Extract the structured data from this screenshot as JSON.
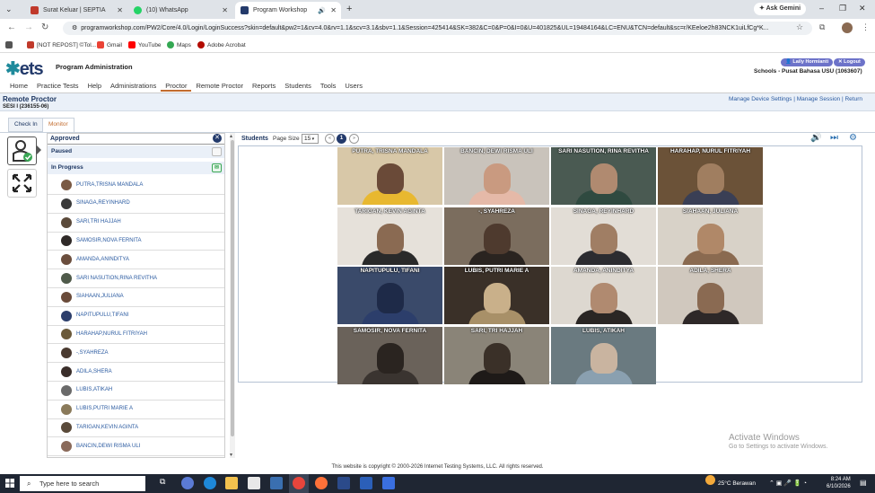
{
  "browser": {
    "tabs": [
      {
        "title": "Surat Keluar | SEPTIA",
        "color": "#c0392b"
      },
      {
        "title": "(10) WhatsApp",
        "color": "#25d366"
      },
      {
        "title": "Program Workshop",
        "color": "#233a6b"
      }
    ],
    "url": "programworkshop.com/PW2/Core/4.0/Login/LoginSuccess?skin=default&pw2=1&cv=4.0&rv=1.1&scv=3.1&sbv=1.1&Session=425414&SK=382&C=0&P=0&I=0&U=401825&UL=19484164&LC=ENU&TCN=default&sc=r/KEeloe2h83NCK1uiLfCg*K...",
    "gemini_label": "Ask Gemini",
    "bookmarks": [
      "[NOT REPOST] ©Tol...",
      "Gmail",
      "YouTube",
      "Maps",
      "Adobe Acrobat"
    ]
  },
  "header": {
    "logo_main": "ets",
    "app_title": "Program Administration",
    "user_button": "Laily Hormianti",
    "logout_button": "Logout",
    "school": "Schools - Pusat Bahasa USU (1063607)"
  },
  "menu": [
    "Home",
    "Practice Tests",
    "Help",
    "Administrations",
    "Proctor",
    "Remote Proctor",
    "Reports",
    "Students",
    "Tools",
    "Users"
  ],
  "menu_selected": "Proctor",
  "subheader": {
    "title": "Remote Proctor",
    "session": "SESI I (236155-06)",
    "links": [
      "Manage Device Settings",
      "Manage Session",
      "Return"
    ]
  },
  "tabs": [
    "Check In",
    "Monitor"
  ],
  "active_tab": "Monitor",
  "left_panel": {
    "approved": "Approved",
    "paused": "Paused",
    "in_progress": "In Progress",
    "students": [
      {
        "name": "PUTRA,TRISNA MANDALA",
        "color": "#7a5a44"
      },
      {
        "name": "SINAGA,REYINHARD",
        "color": "#3a3a3a"
      },
      {
        "name": "SARI,TRI HAJJAH",
        "color": "#5b4a3a"
      },
      {
        "name": "SAMOSIR,NOVA FERNITA",
        "color": "#2f2a28"
      },
      {
        "name": "AMANDA,ANINDITYA",
        "color": "#6b4e3d"
      },
      {
        "name": "SARI NASUTION,RINA REVITHA",
        "color": "#4f5a4a"
      },
      {
        "name": "SIAHAAN,JULIANA",
        "color": "#6a4b3a"
      },
      {
        "name": "NAPITUPULU,TIFANI",
        "color": "#2c3e6b"
      },
      {
        "name": "HARAHAP,NURUL FITRIYAH",
        "color": "#6b5a3a"
      },
      {
        "name": "-,SYAHREZA",
        "color": "#4a3a30"
      },
      {
        "name": "ADILA,SHERA",
        "color": "#3a2e2a"
      },
      {
        "name": "LUBIS,ATIKAH",
        "color": "#6a6a6a"
      },
      {
        "name": "LUBIS,PUTRI MARIE A",
        "color": "#8a7a5a"
      },
      {
        "name": "TARIGAN,KEVIN AGINTA",
        "color": "#5a4a3a"
      },
      {
        "name": "BANCIN,DEWI RISMA ULI",
        "color": "#8a6a5a"
      }
    ]
  },
  "monitor": {
    "students_label": "Students",
    "page_size_label": "Page Size",
    "page_size": "15",
    "page_number": "1",
    "tiles": [
      {
        "label": "PUTRA, TRISNA MANDALA",
        "bg": "#d8c8a8",
        "face": "#6a4a38",
        "body": "#e8b830"
      },
      {
        "label": "BANCIN, DEWI RISMA ULI",
        "bg": "#c9c3bb",
        "face": "#c99a80",
        "body": "#e5b9a8"
      },
      {
        "label": "SARI NASUTION, RINA REVITHA",
        "bg": "#4a5a52",
        "face": "#b08a70",
        "body": "#2f4a40"
      },
      {
        "label": "HARAHAP, NURUL FITRIYAH",
        "bg": "#6b5238",
        "face": "#a07e60",
        "body": "#3a3f55"
      },
      {
        "label": "TARIGAN, KEVIN AGINTA",
        "bg": "#e6e1da",
        "face": "#8a6a52",
        "body": "#2a2a2a"
      },
      {
        "label": "-, SYAHREZA",
        "bg": "#7b6d5e",
        "face": "#4e3a2e",
        "body": "#2a2420"
      },
      {
        "label": "SINAGA, REYINHARD",
        "bg": "#e2ddd6",
        "face": "#a07e64",
        "body": "#2c2c30"
      },
      {
        "label": "SIAHAAN, JULIANA",
        "bg": "#d8d2c8",
        "face": "#b08868",
        "body": "#8a6a50"
      },
      {
        "label": "NAPITUPULU, TIFANI",
        "bg": "#3a4a6a",
        "face": "#1e2a48",
        "body": "#2c3e6b"
      },
      {
        "label": "LUBIS, PUTRI MARIE A",
        "bg": "#3a3028",
        "face": "#c9b08a",
        "body": "#a89068"
      },
      {
        "label": "AMANDA, ANINDITYA",
        "bg": "#ddd8d0",
        "face": "#b08a70",
        "body": "#2a2624"
      },
      {
        "label": "ADILA, SHERA",
        "bg": "#d0c8be",
        "face": "#8a6a52",
        "body": "#2e2828"
      },
      {
        "label": "SAMOSIR, NOVA FERNITA",
        "bg": "#6a625a",
        "face": "#2a2420",
        "body": "#3a3430"
      },
      {
        "label": "SARI, TRI HAJJAH",
        "bg": "#8a8478",
        "face": "#3a3028",
        "body": "#1e1a18"
      },
      {
        "label": "LUBIS, ATIKAH",
        "bg": "#6a7a80",
        "face": "#c9b4a0",
        "body": "#8aa0b0"
      }
    ]
  },
  "watermark": {
    "line1": "Activate Windows",
    "line2": "Go to Settings to activate Windows."
  },
  "footer": "This website is copyright © 2000-2026 Internet Testing Systems, LLC. All rights reserved.",
  "taskbar": {
    "search_placeholder": "Type here to search",
    "weather": "25°C  Berawan",
    "time": "8:24 AM",
    "date": "6/10/2026"
  }
}
